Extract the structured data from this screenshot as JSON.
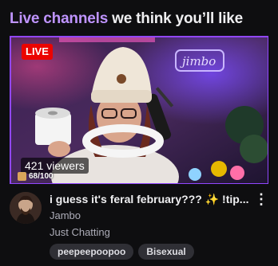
{
  "section": {
    "heading_accent": "Live channels",
    "heading_rest": " we think you’ll like"
  },
  "stream": {
    "live_label": "LIVE",
    "viewers": "421 viewers",
    "overlay_count": "68/100",
    "title": "i guess it's feral february??? ✨ !tip...",
    "channel": "Jambo",
    "category": "Just Chatting",
    "tags": [
      "peepeepoopoo",
      "Bisexual"
    ]
  },
  "colors": {
    "accent": "#bf94ff",
    "live_red": "#eb0400",
    "frame_purple": "#9147ff",
    "background": "#0e0e10"
  },
  "icons": {
    "more": "vertical-ellipsis-icon"
  }
}
